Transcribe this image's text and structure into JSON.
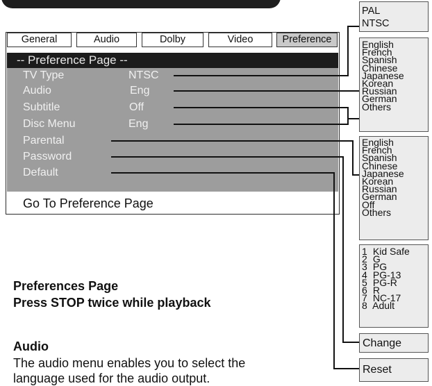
{
  "tabs": [
    {
      "label": "General"
    },
    {
      "label": "Audio"
    },
    {
      "label": "Dolby"
    },
    {
      "label": "Video"
    },
    {
      "label": "Preference"
    }
  ],
  "page_title": "-- Preference Page --",
  "menu": [
    {
      "label": "TV Type",
      "value": "NTSC"
    },
    {
      "label": "Audio",
      "value": "Eng"
    },
    {
      "label": "Subtitle",
      "value": "Off"
    },
    {
      "label": "Disc Menu",
      "value": "Eng"
    },
    {
      "label": "Parental",
      "value": ""
    },
    {
      "label": "Password",
      "value": ""
    },
    {
      "label": "Default",
      "value": ""
    }
  ],
  "goto_label": "Go To Preference Page",
  "tv_type_options": [
    "PAL",
    "NTSC"
  ],
  "language_options": [
    "English",
    "French",
    "Spanish",
    "Chinese",
    "Japanese",
    "Korean",
    "Russian",
    "German",
    "Others"
  ],
  "subtitle_options": [
    "English",
    "French",
    "Spanish",
    "Chinese",
    "Japanese",
    "Korean",
    "Russian",
    "German",
    "Off",
    "Others"
  ],
  "parental_options": [
    {
      "num": "1",
      "label": "Kid Safe"
    },
    {
      "num": "2",
      "label": "G"
    },
    {
      "num": "3",
      "label": "PG"
    },
    {
      "num": "4",
      "label": "PG-13"
    },
    {
      "num": "5",
      "label": "PG-R"
    },
    {
      "num": "6",
      "label": "R"
    },
    {
      "num": "7",
      "label": "NC-17"
    },
    {
      "num": "8",
      "label": "Adult"
    }
  ],
  "change_label": "Change",
  "reset_label": "Reset",
  "text": {
    "heading1": "Preferences Page",
    "heading2": "Press STOP twice while playback",
    "audio_heading": "Audio",
    "audio_line1": "The audio menu enables you to select the",
    "audio_line2": "language used for the audio output."
  }
}
